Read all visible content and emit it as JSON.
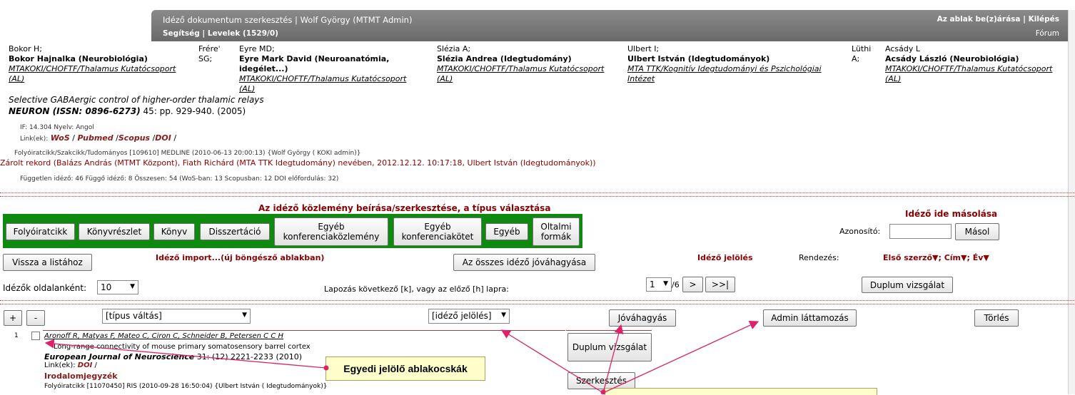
{
  "topbar": {
    "title": "Idéző dokumentum szerkesztés | Wolf György (MTMT Admin)",
    "help": "Segítség",
    "mails": "Levelek (1529/0)",
    "close": "Az ablak be(z)árása",
    "logout": "Kilépés",
    "forum": "Fórum"
  },
  "authors": [
    {
      "short": "Bokor H;",
      "name": "Bokor Hajnalka (Neurobiológia)",
      "aff": "MTAKOKI/CHOFTF/Thalamus Kutatócsoport",
      "aff2": "(AL)"
    },
    {
      "short": "Fréreˈ",
      "short2": "SG;"
    },
    {
      "short": "Eyre MD;",
      "name": "Eyre Mark David (Neuroanatómia,",
      "name2": "idegélet...)",
      "aff": "MTAKOKI/CHOFTF/Thalamus Kutatócsoport",
      "aff2": "(AL)"
    },
    {
      "short": "Slézia A;",
      "name": "Slézia Andrea (Idegtudomány)",
      "aff": "MTAKOKI/CHOFTF/Thalamus Kutatócsoport",
      "aff2": "(AL)"
    },
    {
      "short": "Ulbert I;",
      "name": "Ulbert István (Idegtudományok)",
      "aff": "MTA TTK/Kognitív Idegtudományi és Pszichológiai",
      "aff2": "Intézet"
    },
    {
      "short": "Lüthi",
      "short2": "A;"
    },
    {
      "short": "Acsády L",
      "name": "Acsády László (Neurobiológia)",
      "aff": "MTAKOKI/CHOFTF/Thalamus Kutatócsoport",
      "aff2": "(AL)"
    }
  ],
  "pub": {
    "title": "Selective GABAergic control of higher-order thalamic relays",
    "journal": "NEURON (ISSN: 0896-6273)",
    "vol": " 45: pp. 929-940. (2005)",
    "if": "IF: 14.304 Nyelv: Angol",
    "links_label": "Link(ek):",
    "links": [
      "WoS",
      "Pubmed",
      "Scopus",
      "DOI"
    ],
    "meta": "Folyóiratcikk/Szakcikk/Tudományos [109610] MEDLINE (2010-06-13 20:00:13) {Wolf György ( KOKI admin)}",
    "locked": "Zárolt rekord (Balázs András (MTMT Központ), Fiath Richárd (MTA TTK Idegtudomány) nevében, 2012.12.12. 10:17:18, Ulbert István (Idegtudományok))",
    "counts": "Független idéző: 46 Függő idéző: 8 Összesen: 54 (WoS-ban: 13 Scopusban: 12 DOI előfordulás: 32)"
  },
  "section": {
    "heading": "Az idéző közlemény beírása/szerkesztése, a típus választása",
    "type_buttons": [
      "Folyóiratcikk",
      "Könyvrészlet",
      "Könyv",
      "Disszertáció",
      "Egyéb konferenciaközlemény",
      "Egyéb konferenciakötet",
      "Egyéb",
      "Oltalmi formák"
    ],
    "copy_heading": "Idéző ide másolása",
    "id_label": "Azonosító:",
    "copy_button": "Másol",
    "back_button": "Vissza a listához",
    "import_label": "Idéző import...(új böngésző ablakban)",
    "approve_all": "Az összes idéző jóváhagyása",
    "mark_label": "Idéző jelölés",
    "sort_label": "Rendezés:",
    "sort_options": "Első szerző▼; Cím▼; Év▼",
    "per_page_label": "Idézők oldalanként:",
    "per_page_value": "10",
    "paging_label": "Lapozás következő [k], vagy az előző [h] lapra:",
    "page_value": "1",
    "page_total": "/6",
    "next": ">",
    "last": ">>|",
    "dup_check": "Duplum vizsgálat"
  },
  "list_toolbar": {
    "plus": "+",
    "minus": "-",
    "type_switch": "[típus váltás]",
    "mark_select": "[idéző jelölés]",
    "approve": "Jóváhagyás",
    "admin_review": "Admin láttamozás",
    "delete": "Törlés"
  },
  "citation": {
    "index": "1",
    "authors": "Aronoff R, Matyas F, Mateo C, Ciron C, Schneider B, Petersen C C H",
    "title": "Long-range connectivity of mouse primary somatosensory barrel cortex",
    "journal": "European Journal of Neuroscience",
    "vol": " 31: (12) 2221-2233 (2010)",
    "links_label": "Link(ek):",
    "link": "DOI",
    "refs": "Irodalomjegyzék",
    "meta": "Folyóiratcikk [11070450] RIS (2010-09-28 16:50:04) {Ulbert István ( Idegtudományok)}",
    "dup_button": "Duplum vizsgálat",
    "edit_button": "Szerkesztés"
  },
  "callout": {
    "text": "Egyedi jelölő ablakocskák"
  }
}
